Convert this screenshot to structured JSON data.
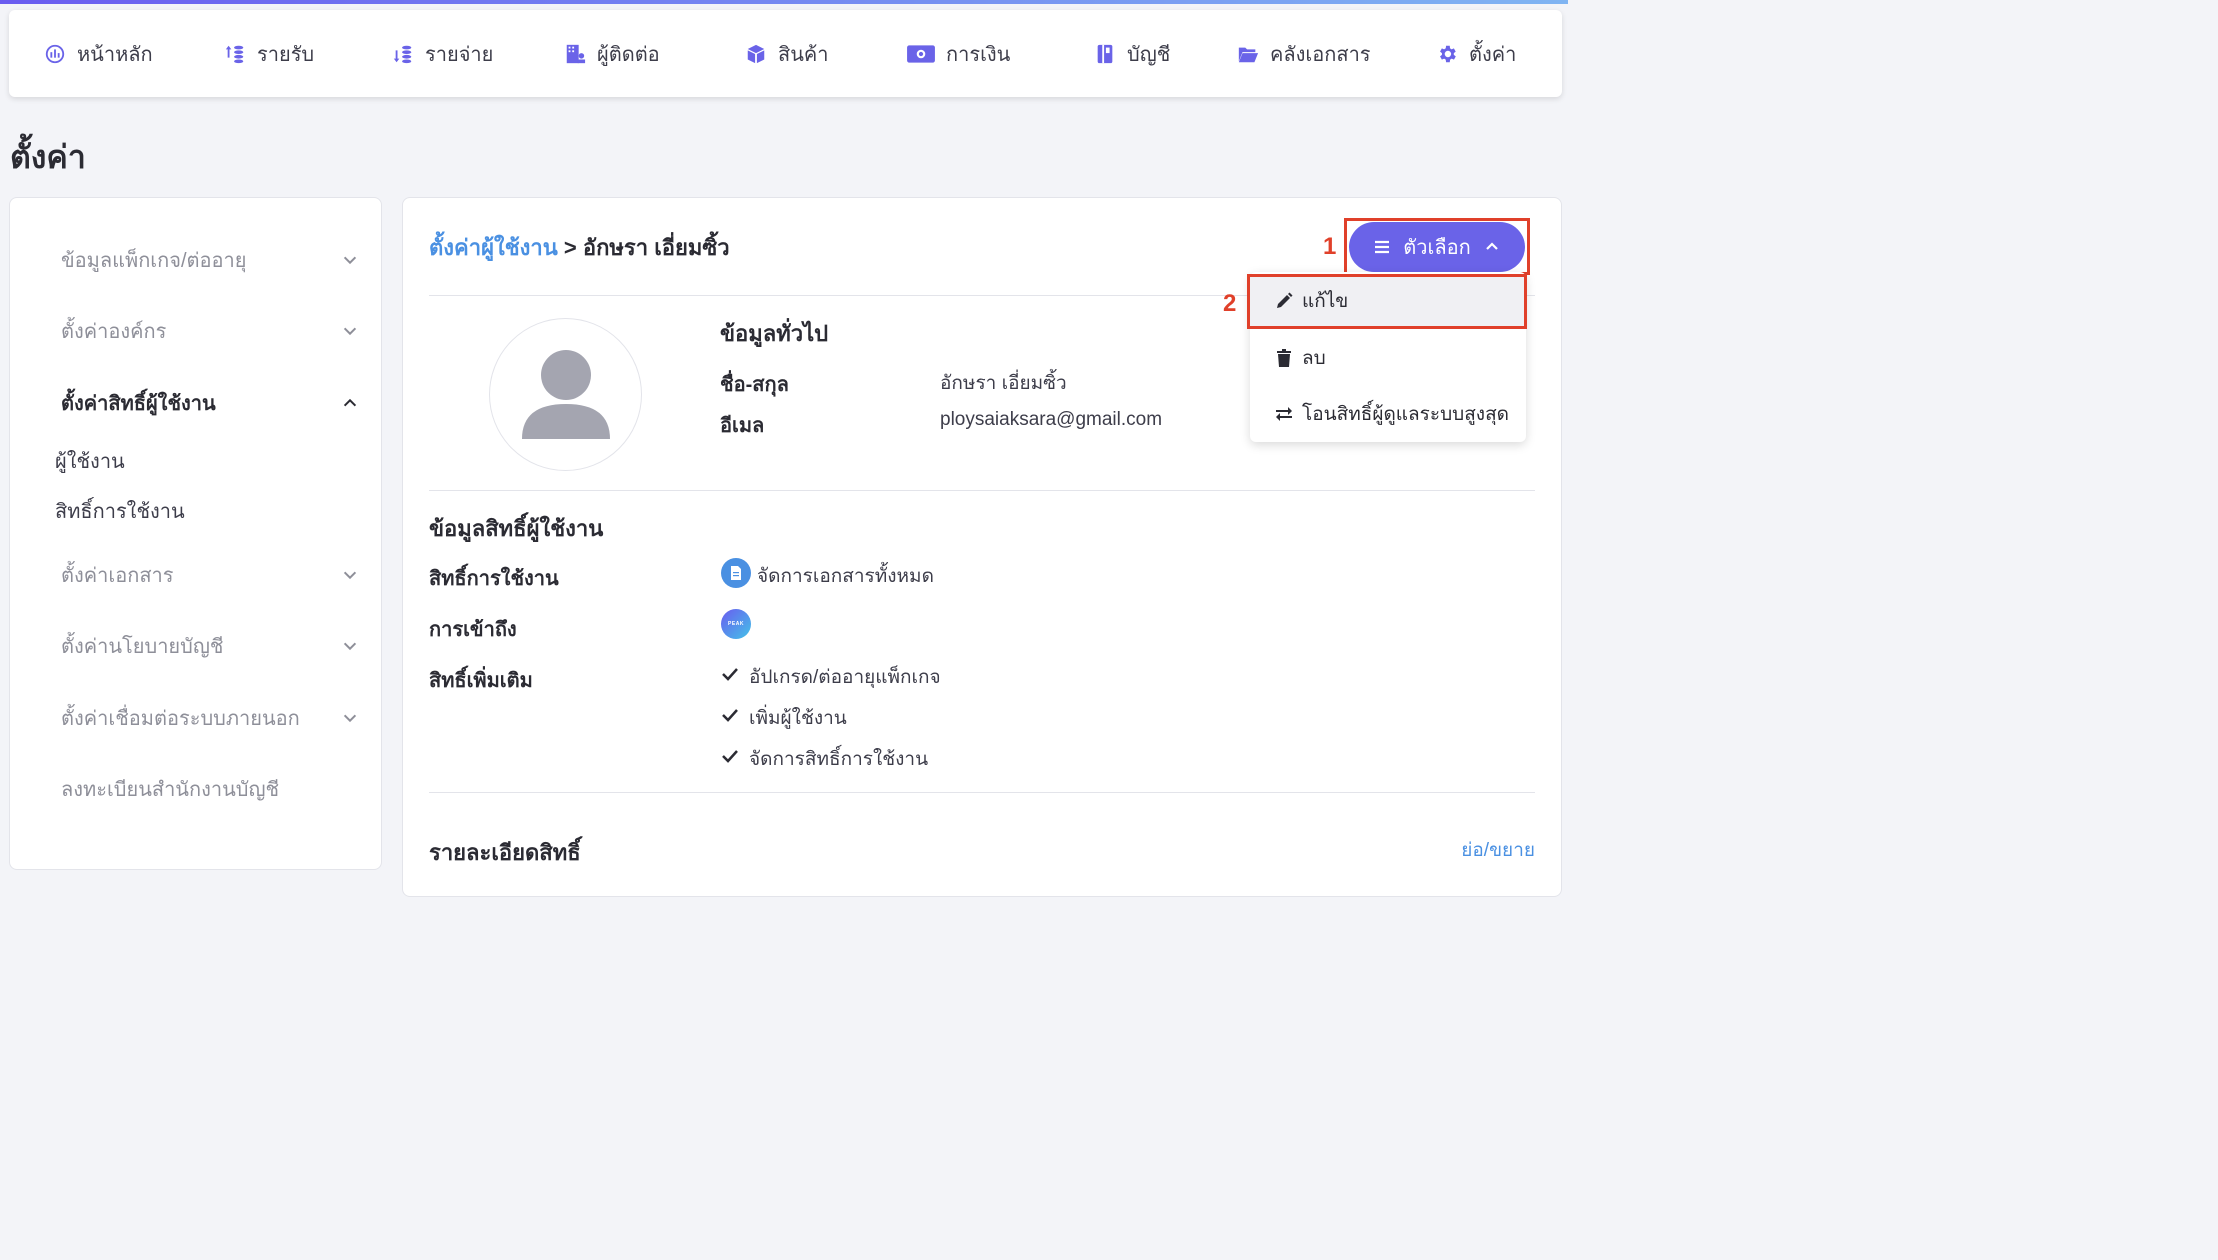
{
  "nav": {
    "items": [
      {
        "label": "หน้าหลัก",
        "icon": "dashboard-icon"
      },
      {
        "label": "รายรับ",
        "icon": "income-icon"
      },
      {
        "label": "รายจ่าย",
        "icon": "expense-icon"
      },
      {
        "label": "ผู้ติดต่อ",
        "icon": "contacts-icon"
      },
      {
        "label": "สินค้า",
        "icon": "product-box-icon"
      },
      {
        "label": "การเงิน",
        "icon": "money-icon"
      },
      {
        "label": "บัญชี",
        "icon": "ledger-book-icon"
      },
      {
        "label": "คลังเอกสาร",
        "icon": "folder-icon"
      },
      {
        "label": "ตั้งค่า",
        "icon": "gear-icon"
      }
    ]
  },
  "page_title": "ตั้งค่า",
  "sidebar": {
    "items": [
      {
        "label": "ข้อมูลแพ็กเกจ/ต่ออายุ"
      },
      {
        "label": "ตั้งค่าองค์กร"
      },
      {
        "label": "ตั้งค่าสิทธิ์ผู้ใช้งาน"
      },
      {
        "label": "ตั้งค่าเอกสาร"
      },
      {
        "label": "ตั้งค่านโยบายบัญชี"
      },
      {
        "label": "ตั้งค่าเชื่อมต่อระบบภายนอก"
      },
      {
        "label": "ลงทะเบียนสำนักงานบัญชี"
      }
    ],
    "sub_items": [
      {
        "label": "ผู้ใช้งาน"
      },
      {
        "label": "สิทธิ์การใช้งาน"
      }
    ]
  },
  "breadcrumb": {
    "link": "ตั้งค่าผู้ใช้งาน",
    "separator": " > ",
    "current": "อักษรา เอี่ยมซิ้ว"
  },
  "general": {
    "title": "ข้อมูลทั่วไป",
    "name_label": "ชื่อ-สกุล",
    "name_value": "อักษรา เอี่ยมซิ้ว",
    "email_label": "อีเมล",
    "email_value": "ploysaiaksara@gmail.com"
  },
  "permissions": {
    "title": "ข้อมูลสิทธิ์ผู้ใช้งาน",
    "usage_label": "สิทธิ์การใช้งาน",
    "usage_value": "จัดการเอกสารทั้งหมด",
    "access_label": "การเข้าถึง",
    "access_badge": "PEAK",
    "extra_label": "สิทธิ์เพิ่มเติม",
    "extra_values": [
      "อัปเกรด/ต่ออายุแพ็กเกจ",
      "เพิ่มผู้ใช้งาน",
      "จัดการสิทธิ์การใช้งาน"
    ]
  },
  "details": {
    "title": "รายละเอียดสิทธิ์",
    "toggle": "ย่อ/ขยาย"
  },
  "options_button": {
    "label": "ตัวเลือก"
  },
  "dropdown": {
    "items": [
      {
        "label": "แก้ไข",
        "icon": "pencil-icon"
      },
      {
        "label": "ลบ",
        "icon": "trash-icon"
      },
      {
        "label": "โอนสิทธิ์ผู้ดูแลระบบสูงสุด",
        "icon": "transfer-icon"
      }
    ]
  },
  "annotations": {
    "marker1": "1",
    "marker2": "2"
  },
  "colors": {
    "accent": "#6a63e8",
    "link": "#4a90e2",
    "highlight_box": "#e0402a"
  }
}
